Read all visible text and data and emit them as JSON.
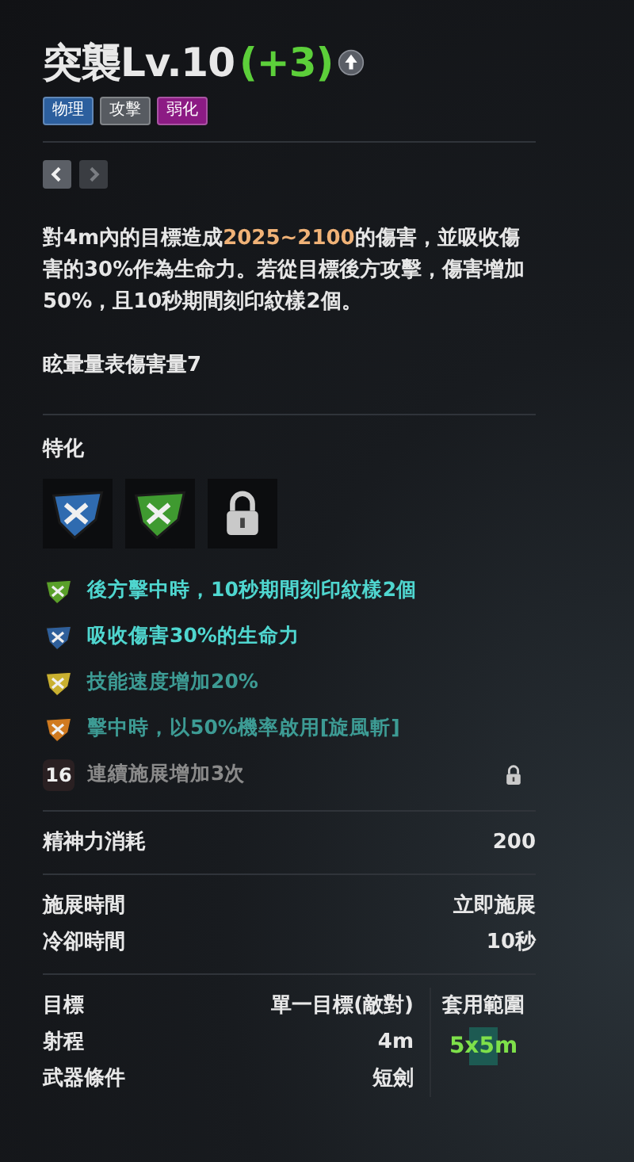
{
  "title": {
    "name": "突襲Lv.10",
    "bonus": "(+3)"
  },
  "tags": [
    {
      "label": "物理",
      "color": "#2c5f9e"
    },
    {
      "label": "攻擊",
      "color": "#575b61"
    },
    {
      "label": "弱化",
      "color": "#8c1b84"
    }
  ],
  "nav": [
    {
      "kind": "prev",
      "disabled": false
    },
    {
      "kind": "next",
      "disabled": true
    }
  ],
  "description": "對4m內的目標造成**2025~2100**的傷害，並吸收傷害的30%作為生命力。若從目標後方攻擊，傷害增加50%，且10秒期間刻印紋樣2個。",
  "stagger": "眩暈量表傷害量7",
  "specialization": {
    "heading": "特化",
    "slots": [
      {
        "kind": "gem",
        "color": "#2f6bb0"
      },
      {
        "kind": "gem",
        "color": "#3f9a30"
      },
      {
        "kind": "locked"
      }
    ]
  },
  "effects": [
    {
      "kind": "gem",
      "color": "#5aa02a",
      "text": "後方擊中時，10秒期間刻印紋樣2個",
      "active": true
    },
    {
      "kind": "gem",
      "color": "#2f5f9a",
      "text": "吸收傷害30%的生命力",
      "active": true
    },
    {
      "kind": "gem",
      "color": "#c9b030",
      "text": "技能速度增加20%",
      "active": false
    },
    {
      "kind": "gem",
      "color": "#d07a20",
      "text": "擊中時，以50%機率啟用[旋風斬]",
      "active": false
    },
    {
      "kind": "level",
      "badge": "16",
      "text": "連續施展增加3次",
      "locked": true
    }
  ],
  "stat_groups": [
    [
      {
        "label": "精神力消耗",
        "value": "200"
      }
    ],
    [
      {
        "label": "施展時間",
        "value": "立即施展"
      },
      {
        "label": "冷卻時間",
        "value": "10秒"
      }
    ]
  ],
  "details": [
    {
      "label": "目標",
      "value": "單一目標(敵對)"
    },
    {
      "label": "射程",
      "value": "4m"
    },
    {
      "label": "武器條件",
      "value": "短劍"
    }
  ],
  "area": {
    "label": "套用範圍",
    "value": "5x5m"
  }
}
